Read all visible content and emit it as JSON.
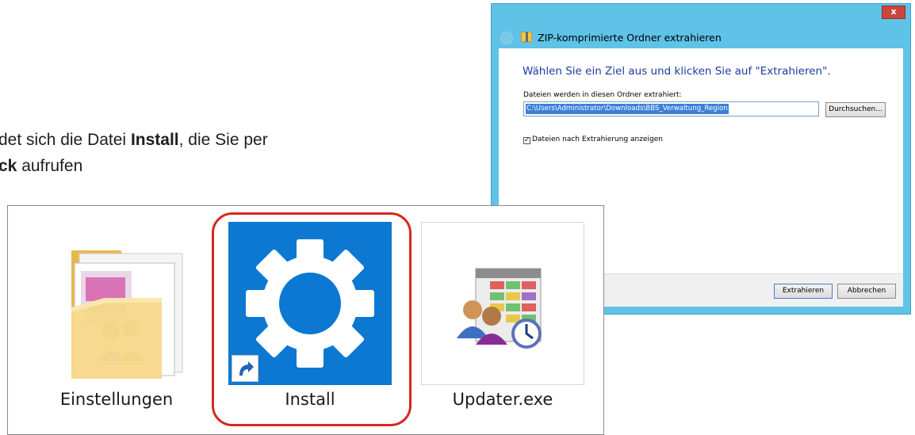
{
  "instruction": {
    "line1_prefix": "det sich die Datei ",
    "line1_bold": "Install",
    "line1_suffix": ", die Sie per",
    "line2_bold": "ck",
    "line2_suffix": " aufrufen"
  },
  "dialog": {
    "close_label": "x",
    "title": "ZIP-komprimierte Ordner extrahieren",
    "heading": "Wählen Sie ein Ziel aus und klicken Sie auf \"Extrahieren\".",
    "folder_label": "Dateien werden in diesen Ordner extrahiert:",
    "path_value": "C:\\Users\\Administrator\\Downloads\\BBS_Verwaltung_Region",
    "browse_label": "Durchsuchen...",
    "show_files_label": "Dateien nach Extrahierung anzeigen",
    "show_files_checked": true,
    "extract_label": "Extrahieren",
    "cancel_label": "Abbrechen"
  },
  "explorer": {
    "items": [
      {
        "label": "Einstellungen",
        "icon": "folder-icon"
      },
      {
        "label": "Install",
        "icon": "gear-icon"
      },
      {
        "label": "Updater.exe",
        "icon": "users-table-clock-icon"
      }
    ],
    "highlight_color": "#d6281f",
    "install_tile_color": "#0c78d2"
  }
}
